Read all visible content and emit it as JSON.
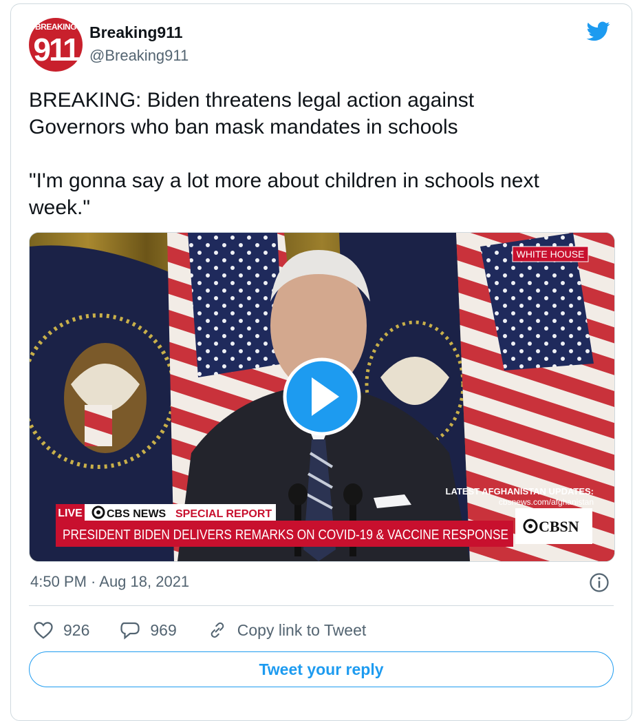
{
  "account": {
    "name": "Breaking911",
    "handle": "@Breaking911",
    "avatar_top": "BREAKING",
    "avatar_num": "911"
  },
  "tweet": {
    "line1": "BREAKING: Biden threatens legal action against",
    "line2": "Governors who ban mask mandates in schools",
    "line3": "\"I'm gonna say a lot more about children in schools next",
    "line4": "week.\"",
    "timestamp": "4:50 PM · Aug 18, 2021"
  },
  "video": {
    "corner_tag": "WHITE HOUSE",
    "side_title": "LATEST AFGHANISTAN UPDATES:",
    "side_url": "cbsnews.com/afghanistan",
    "live_label": "LIVE",
    "network": "CBS NEWS",
    "special_report": "SPECIAL REPORT",
    "headline": "PRESIDENT BIDEN DELIVERS REMARKS ON COVID-19 & VACCINE RESPONSE",
    "cbsn_logo": "CBSN"
  },
  "actions": {
    "likes": "926",
    "replies": "969",
    "copy_link": "Copy link to Tweet",
    "reply_button": "Tweet your reply"
  },
  "colors": {
    "twitter_blue": "#1d9bf0",
    "text_primary": "#0f1419",
    "text_secondary": "#536471",
    "chyron_red": "#c8102e"
  },
  "icons": [
    "twitter-bird-icon",
    "play-icon",
    "info-icon",
    "heart-icon",
    "reply-bubble-icon",
    "link-icon"
  ]
}
